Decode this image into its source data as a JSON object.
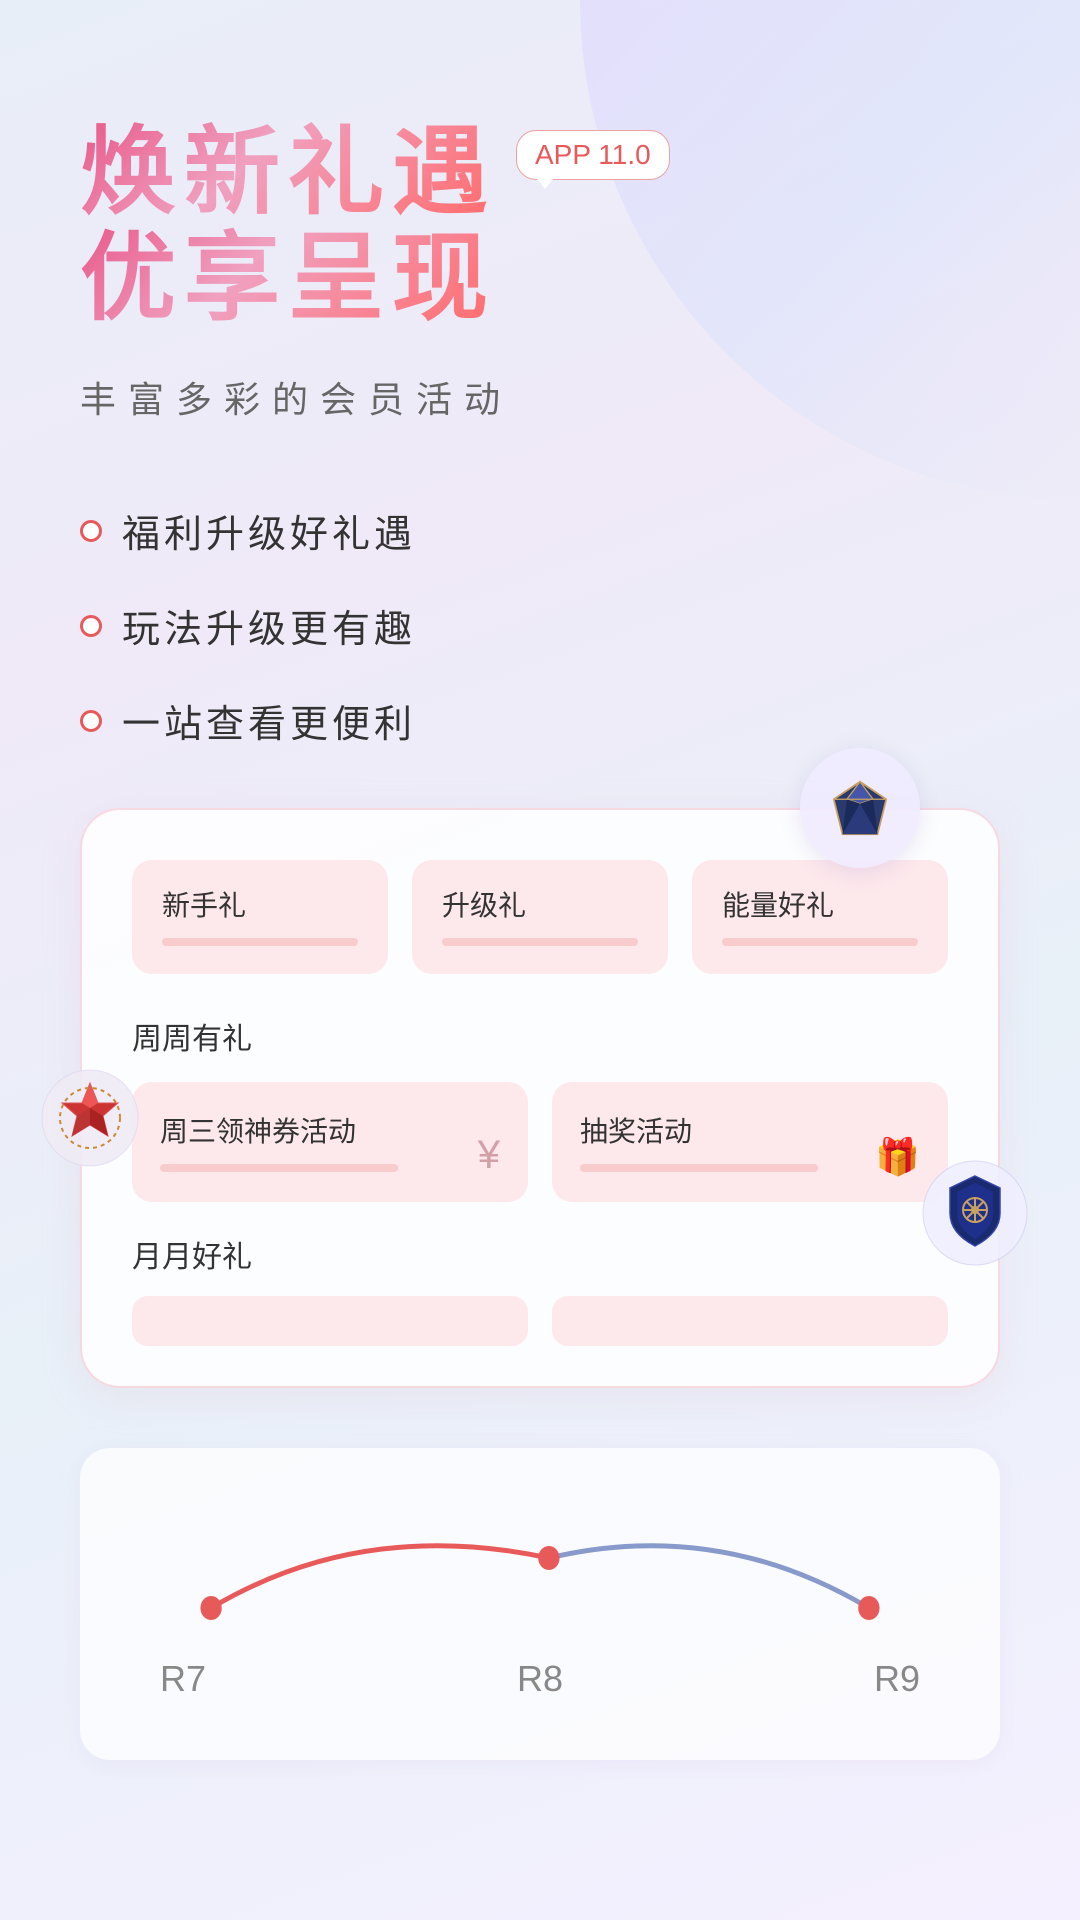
{
  "app": {
    "badge": "APP 11.0"
  },
  "header": {
    "title_line1": "焕新礼遇",
    "title_line2": "优享呈现",
    "subtitle": "丰富多彩的会员活动"
  },
  "features": [
    {
      "text": "福利升级好礼遇"
    },
    {
      "text": "玩法升级更有趣"
    },
    {
      "text": "一站查看更便利"
    }
  ],
  "card": {
    "tabs": [
      {
        "label": "新手礼"
      },
      {
        "label": "升级礼"
      },
      {
        "label": "能量好礼"
      }
    ],
    "section1": {
      "title": "周周有礼",
      "items": [
        {
          "label": "周三领神券活动",
          "icon": "¥"
        },
        {
          "label": "抽奖活动",
          "icon": "🎁"
        }
      ]
    },
    "section2": {
      "title": "月月好礼"
    }
  },
  "progress": {
    "levels": [
      {
        "label": "R7"
      },
      {
        "label": "R8"
      },
      {
        "label": "R9"
      }
    ],
    "colors": {
      "red_curve": "#e85a5a",
      "blue_curve": "#8899cc"
    }
  },
  "icons": {
    "diamond": "💎",
    "gem": "🔴",
    "shield": "🛡️"
  }
}
